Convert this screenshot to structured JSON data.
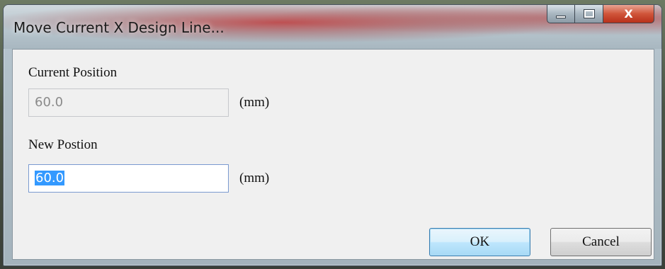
{
  "window": {
    "title": "Move Current X Design Line..."
  },
  "caption_buttons": {
    "minimize_icon": "minimize-icon",
    "maximize_icon": "maximize-icon",
    "close_glyph": "X"
  },
  "current_position": {
    "label": "Current Position",
    "value": "60.0",
    "unit": "(mm)"
  },
  "new_position": {
    "label": "New Postion",
    "value": "60.0",
    "unit": "(mm)"
  },
  "buttons": {
    "ok_label": "OK",
    "cancel_label": "Cancel"
  },
  "colors": {
    "selection": "#3399ff",
    "close_button": "#c8442a"
  }
}
